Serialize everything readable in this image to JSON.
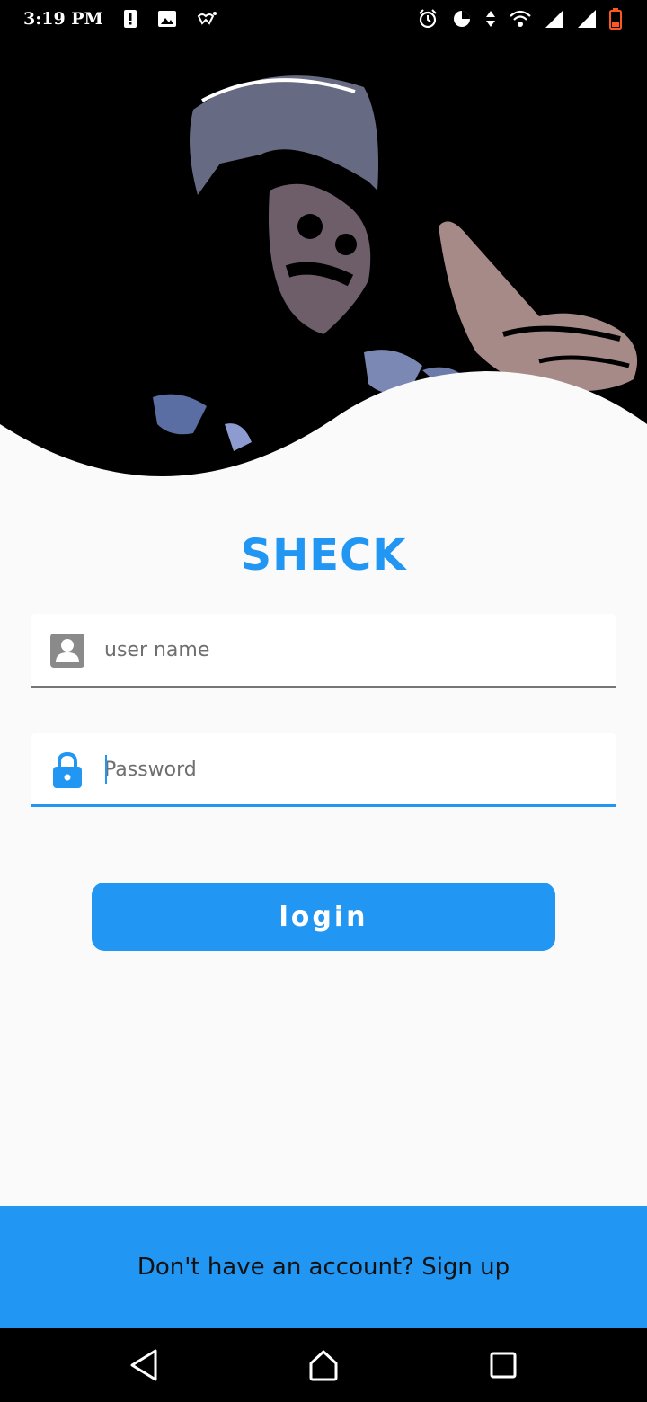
{
  "status_bar": {
    "time": "3:19 PM",
    "left_icons": [
      "alert-icon",
      "image-icon",
      "messenger-icon"
    ],
    "right_icons": [
      "alarm-icon",
      "data-saver-icon",
      "data-arrows-icon",
      "wifi-icon",
      "signal-icon",
      "signal-icon-2",
      "battery-icon"
    ],
    "battery_color": "#ff5722"
  },
  "app": {
    "title": "SHECK",
    "accent_color": "#2196f3"
  },
  "form": {
    "username": {
      "placeholder": "user name",
      "value": ""
    },
    "password": {
      "placeholder": "Password",
      "value": ""
    },
    "login_label": "login"
  },
  "footer": {
    "signup_text": "Don't have an account? Sign up"
  }
}
